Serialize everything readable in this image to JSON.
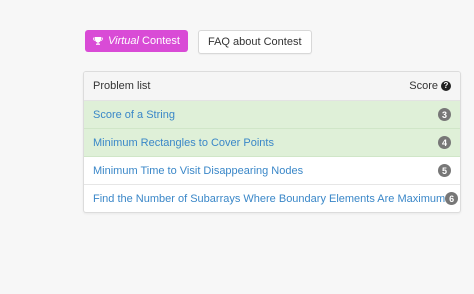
{
  "buttons": {
    "virtual_prefix": "Virtual",
    "virtual_suffix": "Contest",
    "faq": "FAQ about Contest"
  },
  "colors": {
    "virtual_button": "#d94bd6",
    "solved_row": "#dff0d8",
    "link": "#3a87c8",
    "badge": "#777777"
  },
  "problems": {
    "header_label": "Problem list",
    "score_label": "Score",
    "items": [
      {
        "title": "Score of a String",
        "score": "3",
        "solved": true
      },
      {
        "title": "Minimum Rectangles to Cover Points",
        "score": "4",
        "solved": true
      },
      {
        "title": "Minimum Time to Visit Disappearing Nodes",
        "score": "5",
        "solved": false
      },
      {
        "title": "Find the Number of Subarrays Where Boundary Elements Are Maximum",
        "score": "6",
        "solved": false
      }
    ]
  }
}
